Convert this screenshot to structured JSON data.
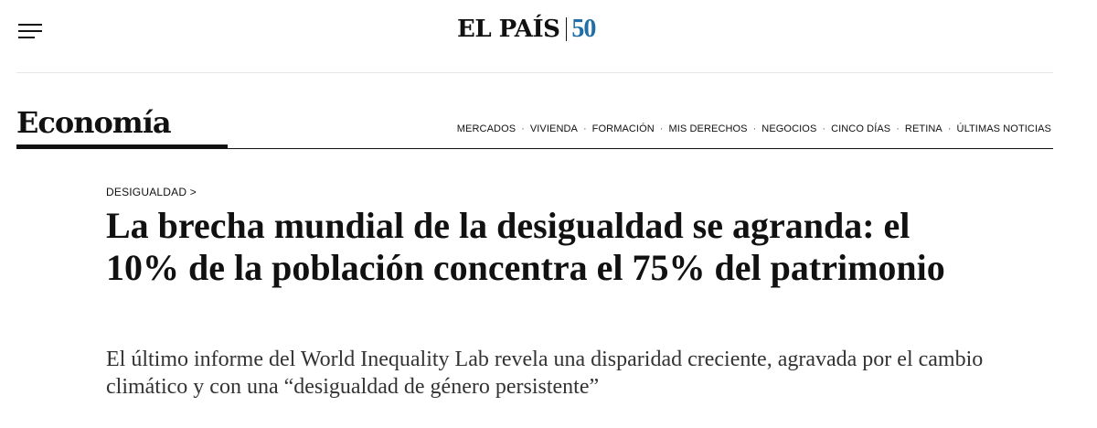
{
  "header": {
    "menu_icon": "hamburger-menu-icon",
    "logo": {
      "name": "EL PAÍS",
      "anniversary": "50",
      "anniversary_color": "#1f6fa6"
    }
  },
  "section": {
    "title": "Economía",
    "nav": [
      "MERCADOS",
      "VIVIENDA",
      "FORMACIÓN",
      "MIS DERECHOS",
      "NEGOCIOS",
      "CINCO DÍAS",
      "RETINA",
      "ÚLTIMAS NOTICIAS"
    ]
  },
  "article": {
    "kicker": "DESIGUALDAD >",
    "headline": "La brecha mundial de la desigualdad se agranda: el 10% de la población concentra el 75% del patrimonio",
    "standfirst": "El último informe del World Inequality Lab revela una disparidad creciente, agravada por el cambio climático y con una “desigualdad de género persistente”"
  }
}
